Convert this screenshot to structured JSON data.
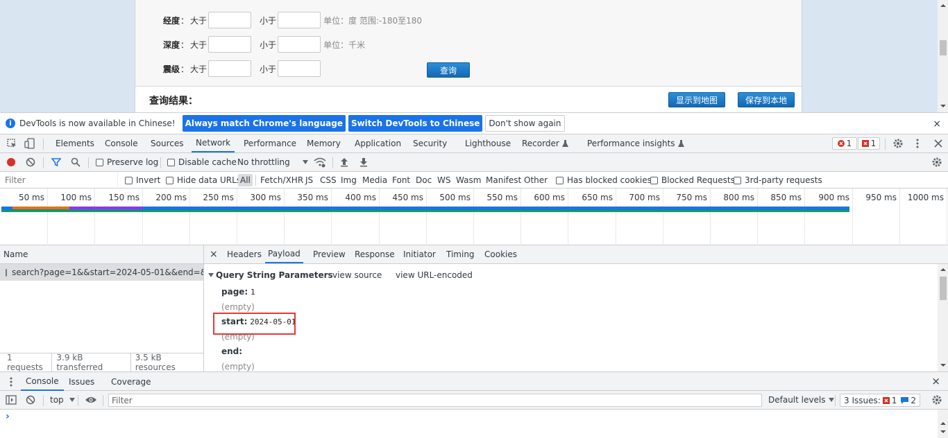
{
  "webpage": {
    "rows": [
      {
        "label": "经度",
        "gt": "大于",
        "lt": "小于",
        "unit": "单位：度 范围:-180至180"
      },
      {
        "label": "深度",
        "gt": "大于",
        "lt": "小于",
        "unit": "单位：千米"
      },
      {
        "label": "震级",
        "gt": "大于",
        "lt": "小于",
        "unit": ""
      }
    ],
    "colon": "：",
    "query_button": "查询",
    "results_title": "查询结果：",
    "show_map_button": "显示到地图",
    "save_local_button": "保存到本地"
  },
  "infobar": {
    "icon": "i",
    "text": "DevTools is now available in Chinese!",
    "btn_match": "Always match Chrome's language",
    "btn_switch": "Switch DevTools to Chinese",
    "btn_dont_show": "Don't show again",
    "close": "×"
  },
  "devtools_tabs": [
    "Elements",
    "Console",
    "Sources",
    "Network",
    "Performance",
    "Memory",
    "Application",
    "Security",
    "Lighthouse",
    "Recorder",
    "Performance insights"
  ],
  "badges": {
    "errors": "1",
    "issues": "1"
  },
  "network_toolbar": {
    "preserve_log": "Preserve log",
    "disable_cache": "Disable cache",
    "throttling": "No throttling"
  },
  "filter_bar": {
    "placeholder": "Filter",
    "invert": "Invert",
    "hide_data_urls": "Hide data URLs",
    "types": [
      "All",
      "Fetch/XHR",
      "JS",
      "CSS",
      "Img",
      "Media",
      "Font",
      "Doc",
      "WS",
      "Wasm",
      "Manifest",
      "Other"
    ],
    "has_blocked_cookies": "Has blocked cookies",
    "blocked_requests": "Blocked Requests",
    "third_party": "3rd-party requests"
  },
  "timeline": {
    "ticks": [
      "50 ms",
      "100 ms",
      "150 ms",
      "200 ms",
      "250 ms",
      "300 ms",
      "350 ms",
      "400 ms",
      "450 ms",
      "500 ms",
      "550 ms",
      "600 ms",
      "650 ms",
      "700 ms",
      "750 ms",
      "800 ms",
      "850 ms",
      "900 ms",
      "950 ms",
      "1000 ms"
    ]
  },
  "request_list": {
    "header": "Name",
    "request": "search?page=1&&start=2024-05-01&&end=&...",
    "status": [
      "1 requests",
      "3.9 kB transferred",
      "3.5 kB resources"
    ]
  },
  "details": {
    "close": "×",
    "tabs": [
      "Headers",
      "Payload",
      "Preview",
      "Response",
      "Initiator",
      "Timing",
      "Cookies"
    ],
    "section_title": "Query String Parameters",
    "view_source": "view source",
    "view_url_encoded": "view URL-encoded",
    "params": [
      {
        "key": "page:",
        "value": "1"
      },
      {
        "key": "start:",
        "value": "2024-05-01"
      },
      {
        "key": "end:",
        "value": ""
      }
    ],
    "empty": "(empty)"
  },
  "drawer": {
    "tabs": [
      "Console",
      "Issues",
      "Coverage"
    ],
    "close": "×",
    "context": "top",
    "filter_placeholder": "Filter",
    "default_levels": "Default levels",
    "issues_label": "3 Issues:",
    "issues_err": "1",
    "issues_info": "2",
    "prompt": "›"
  }
}
